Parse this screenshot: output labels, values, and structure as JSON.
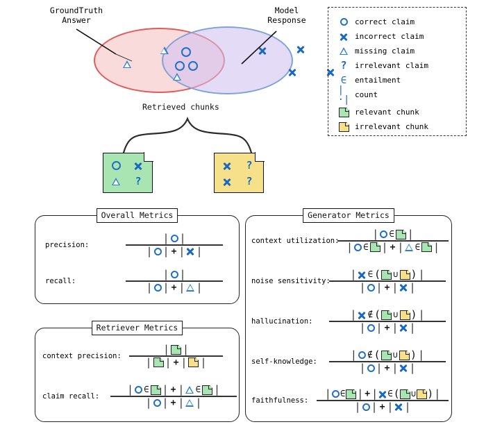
{
  "venn": {
    "left_label": "GroundTruth\nAnswer",
    "left_label_line1": "GroundTruth",
    "left_label_line2": "Answer",
    "right_label_line1": "Model",
    "right_label_line2": "Response",
    "left_fill": "#f5bebe",
    "left_stroke": "#e25a5a",
    "right_fill": "#cdc0f0",
    "right_stroke": "#7fa3d6",
    "left_only_symbols": [
      "missing",
      "missing",
      "missing"
    ],
    "overlap_symbols": [
      "correct",
      "correct",
      "correct"
    ],
    "right_only_symbols": [
      "incorrect",
      "incorrect",
      "incorrect",
      "incorrect"
    ]
  },
  "chunks": {
    "caption": "Retrieved chunks",
    "relevant": {
      "fill": "#a9e5b2",
      "symbols": [
        "correct",
        "incorrect",
        "missing",
        "irrelevant"
      ]
    },
    "irrelevant": {
      "fill": "#f7e08a",
      "symbols": [
        "incorrect",
        "irrelevant",
        "incorrect",
        "irrelevant"
      ]
    }
  },
  "legend": {
    "items": [
      {
        "icon": "circle-icon",
        "label": "correct claim"
      },
      {
        "icon": "cross-icon",
        "label": "incorrect claim"
      },
      {
        "icon": "triangle-icon",
        "label": "missing claim"
      },
      {
        "icon": "question-mark-icon",
        "label": "irrelevant claim"
      },
      {
        "icon": "element-of-icon",
        "label": "entailment"
      },
      {
        "icon": "count-bars-icon",
        "label": "count"
      },
      {
        "icon": "green-chunk-icon",
        "label": "relevant chunk"
      },
      {
        "icon": "yellow-chunk-icon",
        "label": "irrelevant chunk"
      }
    ],
    "symbol_glyphs": {
      "element_of": "∈",
      "not_element_of": "∉",
      "union": "∪",
      "count": "|·|",
      "question": "?"
    }
  },
  "panels": {
    "overall": {
      "title": "Overall Metrics",
      "metrics": [
        {
          "name": "precision:",
          "numerator": "|O|",
          "denominator": "|O|+|X|"
        },
        {
          "name": "recall:",
          "numerator": "|O|",
          "denominator": "|O|+|△|"
        }
      ]
    },
    "retriever": {
      "title": "Retriever Metrics",
      "metrics": [
        {
          "name": "context precision:",
          "numerator": "|green|",
          "denominator": "|green|+|yellow|"
        },
        {
          "name": "claim recall:",
          "numerator": "|O ∈ green|+|△ ∈ green|",
          "denominator": "|O|+|△|"
        }
      ]
    },
    "generator": {
      "title": "Generator Metrics",
      "metrics": [
        {
          "name": "context utilization:",
          "numerator": "|O ∈ green|",
          "denominator": "|O ∈ green|+|△ ∈ green|"
        },
        {
          "name": "noise sensitivity:",
          "numerator": "|X ∈ (green ∪ yellow)|",
          "denominator": "|O|+|X|"
        },
        {
          "name": "hallucination:",
          "numerator": "|X ∉ (green ∪ yellow)|",
          "denominator": "|O|+|X|"
        },
        {
          "name": "self-knowledge:",
          "numerator": "|O ∉ (green ∪ yellow)|",
          "denominator": "|O|+|X|"
        },
        {
          "name": "faithfulness:",
          "numerator": "|O ∈ green|+|X ∈ (green ∪ yellow)|",
          "denominator": "|O|+|X|"
        }
      ]
    }
  },
  "colors": {
    "claim_blue": "#1a68bf",
    "relevant_chunk": "#a9e5b2",
    "irrelevant_chunk": "#f7e08a",
    "groundtruth_red": "#e25a5a",
    "model_blue": "#7fa3d6"
  }
}
